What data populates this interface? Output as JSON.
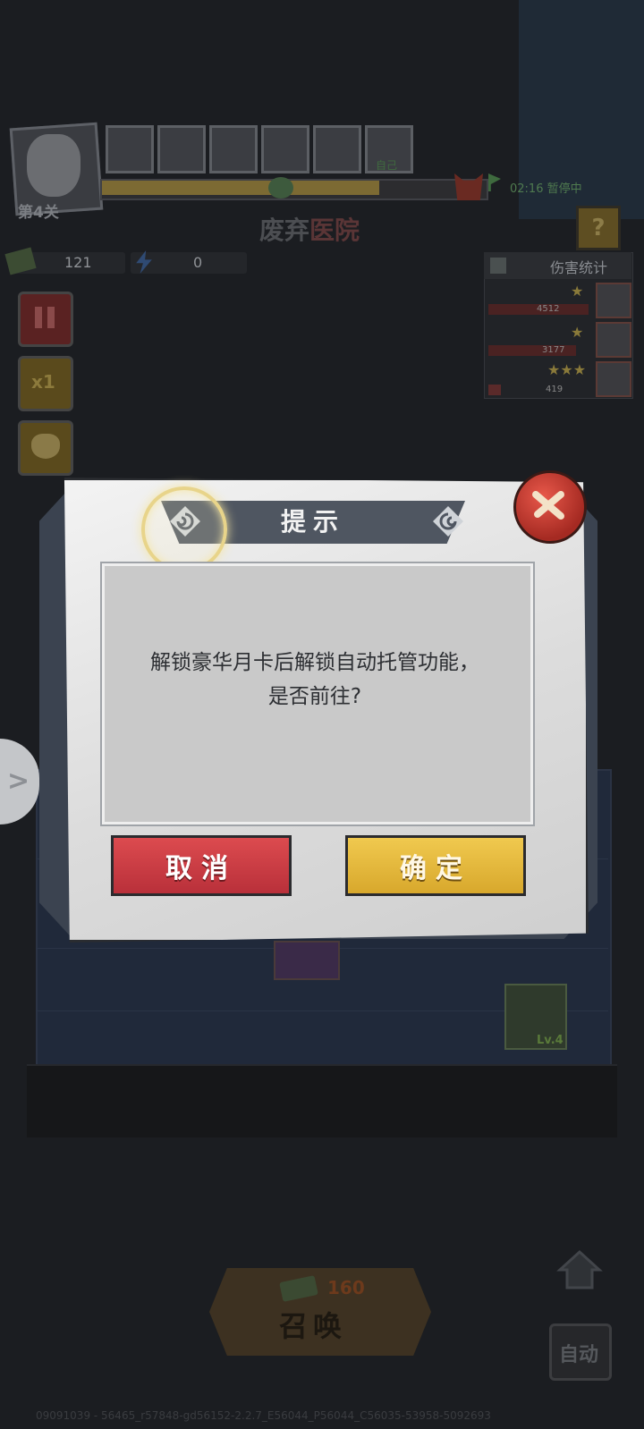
{
  "hud": {
    "level": "第4关",
    "area_title_a": "废弃",
    "area_title_b": "医院",
    "timer": "02:16 暂停中",
    "self_label": "自己",
    "cash": "121",
    "energy": "0",
    "speed_label": "x1",
    "help_label": "?",
    "progress": 0.72
  },
  "damage_stats": {
    "title": "伤害统计",
    "rows": [
      {
        "value": "4512",
        "stars": "★"
      },
      {
        "value": "3177",
        "stars": "★"
      },
      {
        "value": "419",
        "stars": "★★★"
      }
    ]
  },
  "board": {
    "unit_level": "Lv.4"
  },
  "dialog": {
    "title": "提示",
    "message_line1": "解锁豪华月卡后解锁自动托管功能，",
    "message_line2": "是否前往?",
    "cancel_label": "取消",
    "confirm_label": "确定"
  },
  "bottom": {
    "summon_label": "召唤",
    "summon_cost": "160",
    "auto_label": "自动",
    "footer_text": "09091039 - 56465_r57848-gd56152-2.2.7_E56044_P56044_C56035-53958-5092693"
  },
  "colors": {
    "cancel": "#cf3d45",
    "confirm": "#e6b93c",
    "dialog_title_band": "#4f5661"
  }
}
